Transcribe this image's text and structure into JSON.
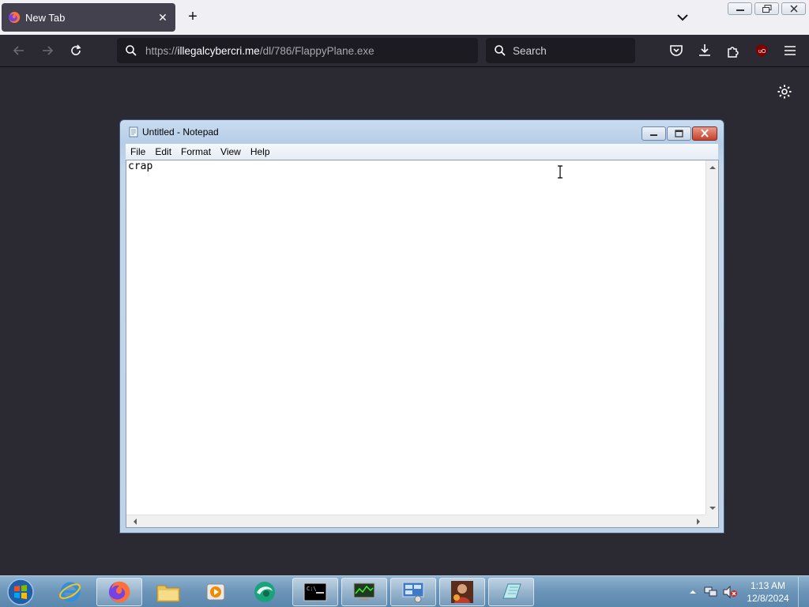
{
  "browser": {
    "tab": {
      "title": "New Tab"
    },
    "url": {
      "host": "illegalcybercri.me",
      "scheme": "https://",
      "path": "/dl/786/FlappyPlane.exe"
    },
    "search": {
      "placeholder": "Search"
    }
  },
  "notepad": {
    "title": "Untitled - Notepad",
    "menu": [
      "File",
      "Edit",
      "Format",
      "View",
      "Help"
    ],
    "content": "crap"
  },
  "taskbar": {
    "apps": [
      "internet-explorer",
      "firefox",
      "file-explorer",
      "media-player",
      "app-swirl",
      "command-prompt",
      "task-manager",
      "control-panel",
      "game",
      "notepad"
    ],
    "clock": {
      "time": "1:13 AM",
      "date": "12/8/2024"
    }
  },
  "colors": {
    "browser_bg": "#2b2a33",
    "urlbar_bg": "#1c1b22",
    "taskbar": "#6b94b8"
  }
}
